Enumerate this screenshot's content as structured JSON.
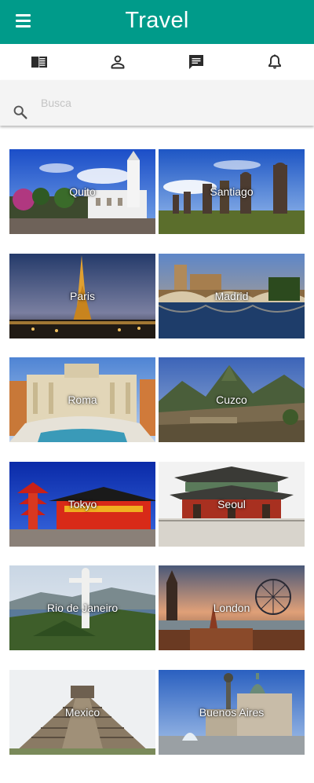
{
  "app": {
    "title": "Travel"
  },
  "toolbar": {
    "items": [
      "book-icon",
      "person-icon",
      "chat-icon",
      "bell-icon"
    ]
  },
  "search": {
    "placeholder": "Busca",
    "value": ""
  },
  "destinations": [
    {
      "label": "Quito"
    },
    {
      "label": "Santiago"
    },
    {
      "label": "Paris"
    },
    {
      "label": "Madrid"
    },
    {
      "label": "Roma"
    },
    {
      "label": "Cuzco"
    },
    {
      "label": "Tokyo"
    },
    {
      "label": "Seoul"
    },
    {
      "label": "Rio de Janeiro"
    },
    {
      "label": "London"
    },
    {
      "label": "Mexico"
    },
    {
      "label": "Buenos Aires"
    }
  ],
  "colors": {
    "appbar": "#009b8a",
    "icon": "#2b2b2b"
  }
}
